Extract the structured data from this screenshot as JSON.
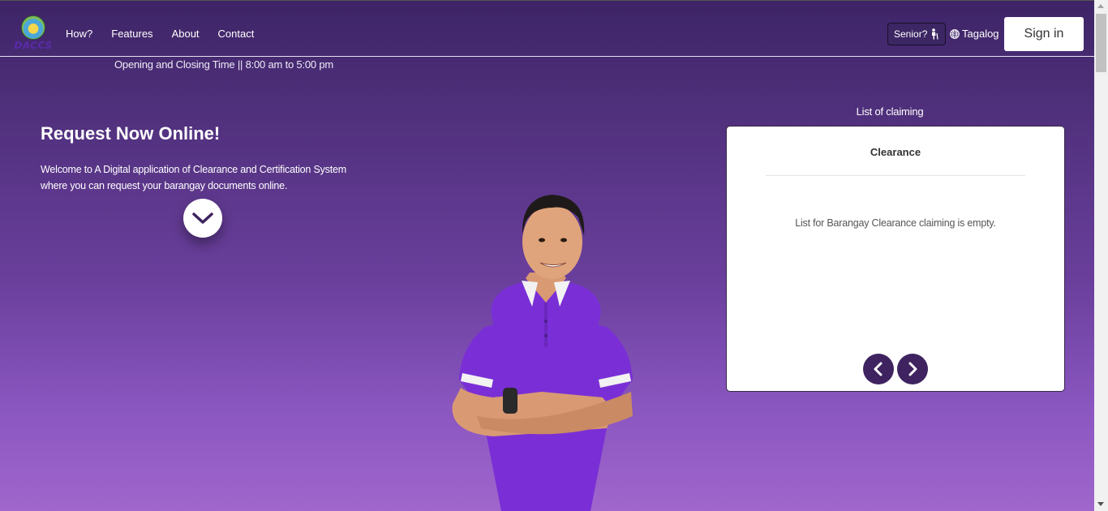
{
  "brand": {
    "logo_text": "DACCS"
  },
  "nav": {
    "links": [
      "How?",
      "Features",
      "About",
      "Contact"
    ],
    "senior_label": "Senior?",
    "language_label": "Tagalog",
    "signin_label": "Sign in"
  },
  "hours": "Opening and Closing Time || 8:00 am to 5:00 pm",
  "hero": {
    "title": "Request Now Online!",
    "description": "Welcome to A Digital application of Clearance and Certification System where you can request your barangay documents online."
  },
  "claiming": {
    "heading": "List of claiming",
    "card_title": "Clearance",
    "empty_message": "List for Barangay Clearance claiming is empty."
  },
  "icons": {
    "scroll_down": "chevron-down-icon",
    "prev": "chevron-left-icon",
    "next": "chevron-right-icon",
    "senior": "elderly-person-icon",
    "language": "globe-icon"
  },
  "colors": {
    "bg_top": "#3d2466",
    "bg_bottom": "#a066cc",
    "arrow_button": "#3e2360",
    "shirt": "#7a2fd6"
  }
}
